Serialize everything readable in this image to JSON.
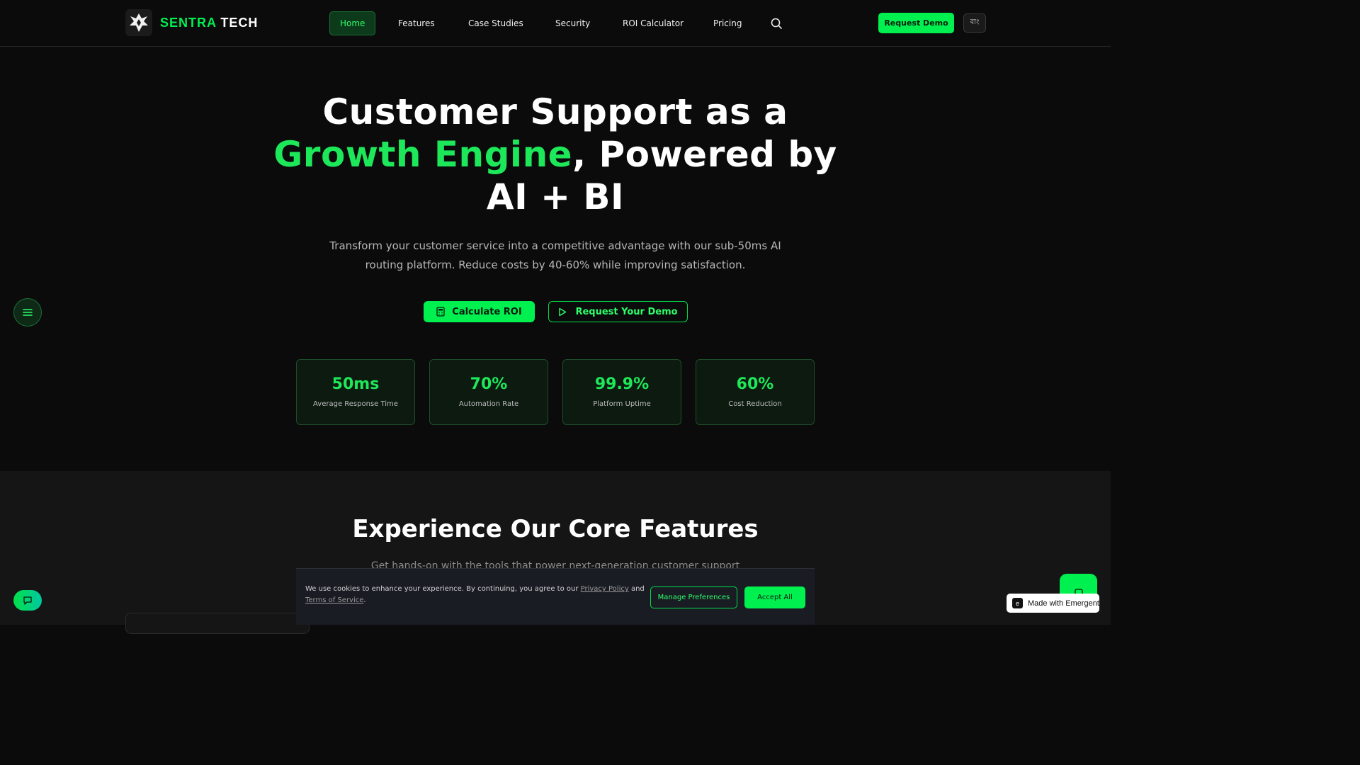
{
  "brand": {
    "name_part1": "SENTRA",
    "name_part2": "TECH"
  },
  "nav": {
    "items": [
      {
        "label": "Home",
        "active": true
      },
      {
        "label": "Features"
      },
      {
        "label": "Case Studies"
      },
      {
        "label": "Security"
      },
      {
        "label": "ROI Calculator"
      },
      {
        "label": "Pricing"
      }
    ],
    "search_icon": "search-icon"
  },
  "header": {
    "demo_label": "Request Demo",
    "lang_label": "বাং"
  },
  "hero": {
    "title_line1": "Customer Support as a",
    "title_accent": "Growth Engine",
    "title_after_accent": ", Powered by",
    "title_line3": "AI + BI",
    "subtitle": "Transform your customer service into a competitive advantage with our sub-50ms AI routing platform. Reduce costs by 40-60% while improving satisfaction.",
    "primary_cta": "Calculate ROI",
    "secondary_cta": "Request Your Demo"
  },
  "stats": [
    {
      "value": "50ms",
      "label": "Average Response Time"
    },
    {
      "value": "70%",
      "label": "Automation Rate"
    },
    {
      "value": "99.9%",
      "label": "Platform Uptime"
    },
    {
      "value": "60%",
      "label": "Cost Reduction"
    }
  ],
  "features": {
    "title": "Experience Our Core Features",
    "subtitle": "Get hands-on with the tools that power next-generation customer support"
  },
  "cookie": {
    "text_before": "We use cookies to enhance your experience. By continuing, you agree to our ",
    "privacy_link": "Privacy Policy",
    "text_middle": " and ",
    "terms_link": "Terms of Service",
    "text_end": ".",
    "manage_label": "Manage Preferences",
    "accept_label": "Accept All"
  },
  "footer_badge": {
    "label": "Made with Emergent",
    "icon": "e"
  },
  "colors": {
    "accent": "#00f050",
    "background": "#0b0b0b",
    "section_bg": "#151515"
  }
}
